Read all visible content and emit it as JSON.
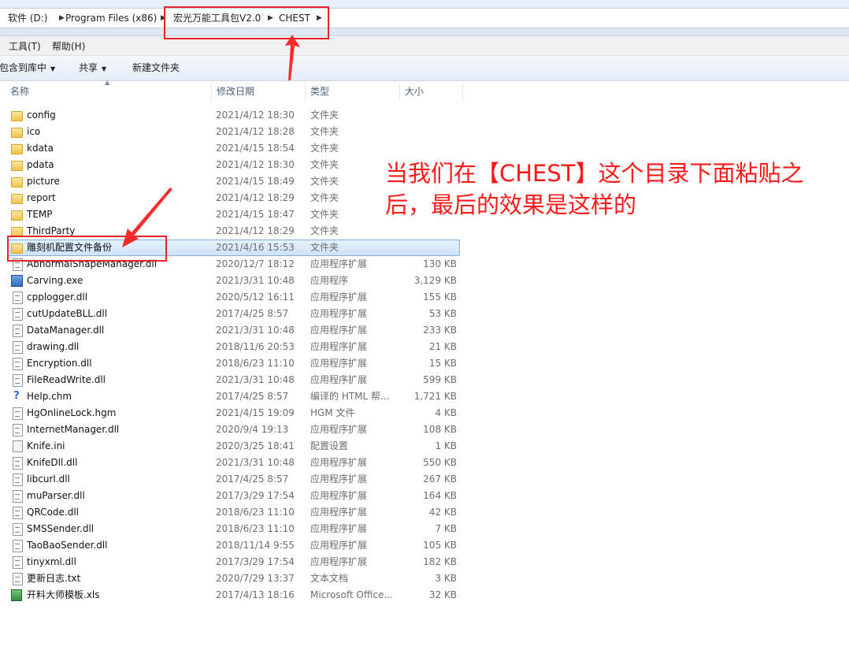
{
  "breadcrumb": {
    "items": [
      "软件 (D:)",
      "Program Files (x86)",
      "宏光万能工具包V2.0",
      "CHEST"
    ]
  },
  "menu": {
    "items": [
      "工具(T)",
      "帮助(H)"
    ]
  },
  "toolbar": {
    "include_library": "包含到库中",
    "share": "共享",
    "new_folder": "新建文件夹"
  },
  "columns": {
    "name": "名称",
    "date": "修改日期",
    "type": "类型",
    "size": "大小"
  },
  "files": [
    {
      "name": "config",
      "date": "2021/4/12 18:30",
      "type": "文件夹",
      "size": "",
      "icon": "folder-icon"
    },
    {
      "name": "ico",
      "date": "2021/4/12 18:28",
      "type": "文件夹",
      "size": "",
      "icon": "folder-icon"
    },
    {
      "name": "kdata",
      "date": "2021/4/15 18:54",
      "type": "文件夹",
      "size": "",
      "icon": "folder-icon"
    },
    {
      "name": "pdata",
      "date": "2021/4/12 18:30",
      "type": "文件夹",
      "size": "",
      "icon": "folder-icon"
    },
    {
      "name": "picture",
      "date": "2021/4/15 18:49",
      "type": "文件夹",
      "size": "",
      "icon": "folder-icon"
    },
    {
      "name": "report",
      "date": "2021/4/12 18:29",
      "type": "文件夹",
      "size": "",
      "icon": "folder-icon"
    },
    {
      "name": "TEMP",
      "date": "2021/4/15 18:47",
      "type": "文件夹",
      "size": "",
      "icon": "folder-icon"
    },
    {
      "name": "ThirdParty",
      "date": "2021/4/12 18:29",
      "type": "文件夹",
      "size": "",
      "icon": "folder-icon"
    },
    {
      "name": "雕刻机配置文件备份",
      "date": "2021/4/16 15:53",
      "type": "文件夹",
      "size": "",
      "icon": "folder-icon",
      "selected": true
    },
    {
      "name": "AbnormalShapeManager.dll",
      "date": "2020/12/7 18:12",
      "type": "应用程序扩展",
      "size": "130 KB",
      "icon": "dll-icon"
    },
    {
      "name": "Carving.exe",
      "date": "2021/3/31 10:48",
      "type": "应用程序",
      "size": "3,129 KB",
      "icon": "exe-icon"
    },
    {
      "name": "cpplogger.dll",
      "date": "2020/5/12 16:11",
      "type": "应用程序扩展",
      "size": "155 KB",
      "icon": "dll-icon"
    },
    {
      "name": "cutUpdateBLL.dll",
      "date": "2017/4/25 8:57",
      "type": "应用程序扩展",
      "size": "53 KB",
      "icon": "dll-icon"
    },
    {
      "name": "DataManager.dll",
      "date": "2021/3/31 10:48",
      "type": "应用程序扩展",
      "size": "233 KB",
      "icon": "dll-icon"
    },
    {
      "name": "drawing.dll",
      "date": "2018/11/6 20:53",
      "type": "应用程序扩展",
      "size": "21 KB",
      "icon": "dll-icon"
    },
    {
      "name": "Encryption.dll",
      "date": "2018/6/23 11:10",
      "type": "应用程序扩展",
      "size": "15 KB",
      "icon": "dll-icon"
    },
    {
      "name": "FileReadWrite.dll",
      "date": "2021/3/31 10:48",
      "type": "应用程序扩展",
      "size": "599 KB",
      "icon": "dll-icon"
    },
    {
      "name": "Help.chm",
      "date": "2017/4/25 8:57",
      "type": "编译的 HTML 帮...",
      "size": "1,721 KB",
      "icon": "help-icon"
    },
    {
      "name": "HgOnlineLock.hgm",
      "date": "2021/4/15 19:09",
      "type": "HGM 文件",
      "size": "4 KB",
      "icon": "file-icon"
    },
    {
      "name": "InternetManager.dll",
      "date": "2020/9/4 19:13",
      "type": "应用程序扩展",
      "size": "108 KB",
      "icon": "dll-icon"
    },
    {
      "name": "Knife.ini",
      "date": "2020/3/25 18:41",
      "type": "配置设置",
      "size": "1 KB",
      "icon": "ini-icon"
    },
    {
      "name": "KnifeDll.dll",
      "date": "2021/3/31 10:48",
      "type": "应用程序扩展",
      "size": "550 KB",
      "icon": "dll-icon"
    },
    {
      "name": "libcurl.dll",
      "date": "2017/4/25 8:57",
      "type": "应用程序扩展",
      "size": "267 KB",
      "icon": "dll-icon"
    },
    {
      "name": "muParser.dll",
      "date": "2017/3/29 17:54",
      "type": "应用程序扩展",
      "size": "164 KB",
      "icon": "dll-icon"
    },
    {
      "name": "QRCode.dll",
      "date": "2018/6/23 11:10",
      "type": "应用程序扩展",
      "size": "42 KB",
      "icon": "dll-icon"
    },
    {
      "name": "SMSSender.dll",
      "date": "2018/6/23 11:10",
      "type": "应用程序扩展",
      "size": "7 KB",
      "icon": "dll-icon"
    },
    {
      "name": "TaoBaoSender.dll",
      "date": "2018/11/14 9:55",
      "type": "应用程序扩展",
      "size": "105 KB",
      "icon": "dll-icon"
    },
    {
      "name": "tinyxml.dll",
      "date": "2017/3/29 17:54",
      "type": "应用程序扩展",
      "size": "182 KB",
      "icon": "dll-icon"
    },
    {
      "name": "更新日志.txt",
      "date": "2020/7/29 13:37",
      "type": "文本文档",
      "size": "3 KB",
      "icon": "text-icon"
    },
    {
      "name": "开料大师模板.xls",
      "date": "2017/4/13 18:16",
      "type": "Microsoft Office...",
      "size": "32 KB",
      "icon": "excel-icon"
    }
  ],
  "annotation": {
    "line1": "当我们在【CHEST】这个目录下面粘贴之",
    "line2": "后，最后的效果是这样的",
    "color": "#ff1a1a"
  },
  "colors": {
    "highlight": "#e8232a",
    "selection": "#cde3fb"
  }
}
